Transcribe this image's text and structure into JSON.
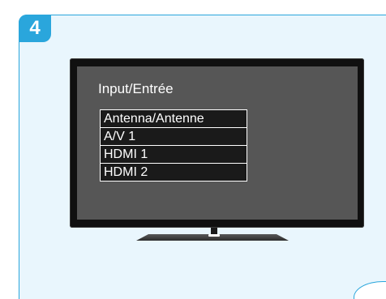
{
  "step": {
    "number": "4"
  },
  "tv": {
    "menu_title": "Input/Entrée",
    "inputs": [
      {
        "label": "Antenna/Antenne"
      },
      {
        "label": "A/V 1"
      },
      {
        "label": "HDMI 1"
      },
      {
        "label": "HDMI 2"
      }
    ]
  },
  "colors": {
    "accent": "#2aa6dc",
    "panel_background": "#e9f6fd",
    "screen": "#565656",
    "menu_item": "#1a1a1a"
  }
}
